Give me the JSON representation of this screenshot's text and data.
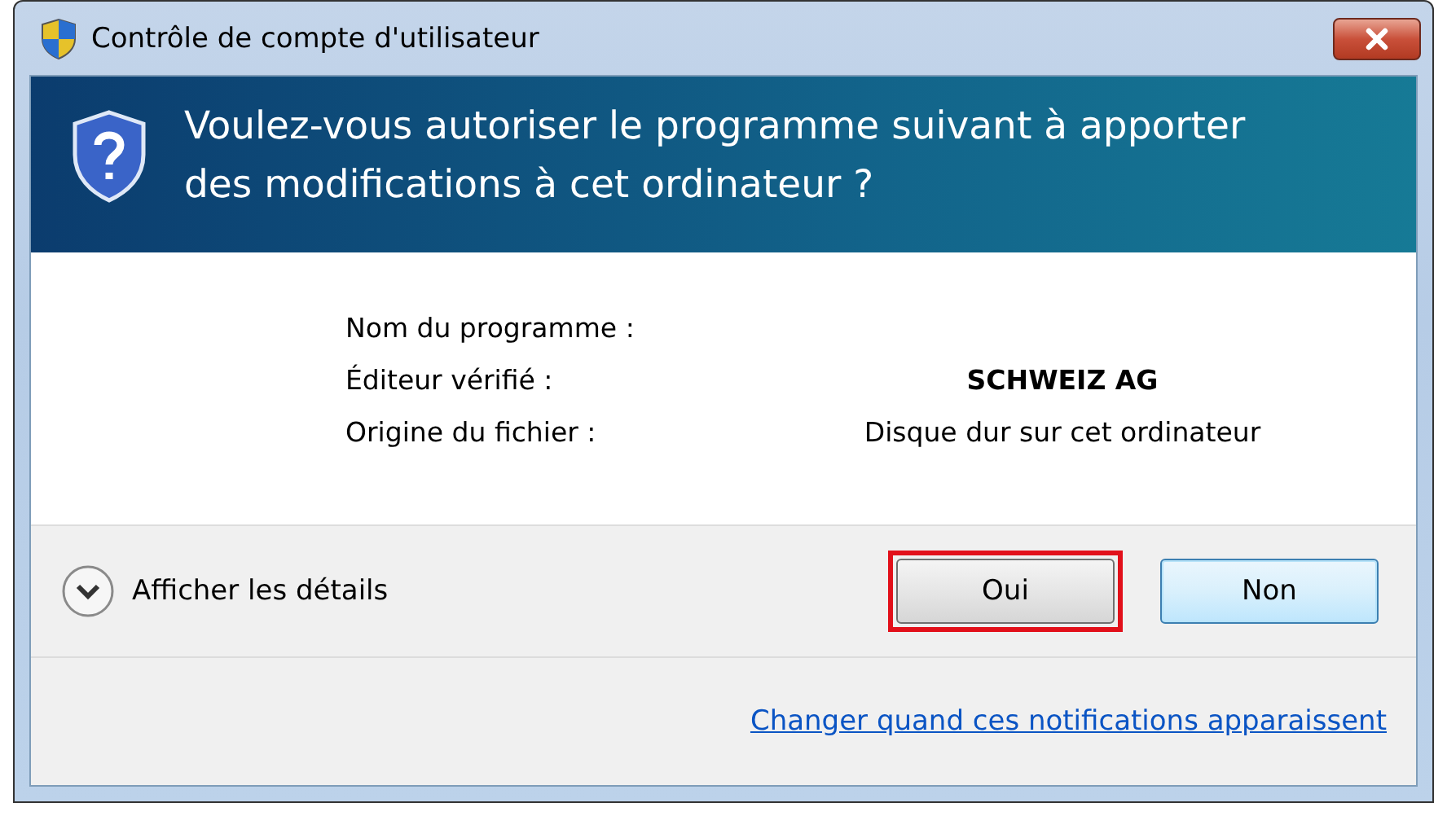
{
  "window": {
    "title": "Contrôle de compte d'utilisateur"
  },
  "header": {
    "question": "Voulez-vous autoriser le programme suivant à apporter des modifications à cet ordinateur ?"
  },
  "details": [
    {
      "label": "Nom du programme :"
    },
    {
      "label": "Éditeur vérifié :",
      "value": "SCHWEIZ AG",
      "kind": "bold"
    },
    {
      "label": "Origine du fichier :",
      "value": "Disque dur sur cet ordinateur",
      "kind": "plain"
    }
  ],
  "toggle": {
    "label": "Afficher les détails",
    "expanded": false
  },
  "buttons": [
    {
      "label": "Oui",
      "highlighted": true,
      "focused": false
    },
    {
      "label": "Non",
      "highlighted": false,
      "focused": true
    }
  ],
  "link": "Changer quand ces notifications apparaissent"
}
